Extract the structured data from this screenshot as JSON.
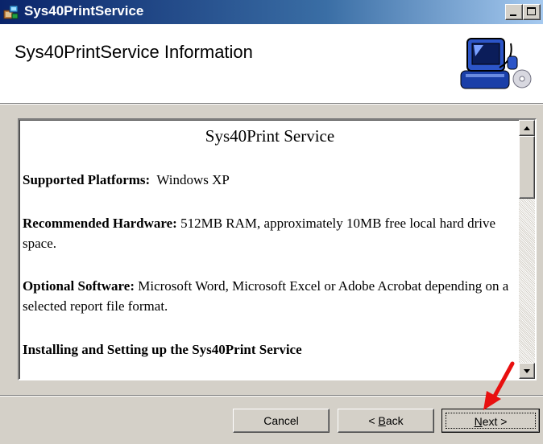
{
  "window": {
    "title": "Sys40PrintService",
    "icon": "installer-icon"
  },
  "header": {
    "heading": "Sys40PrintService Information",
    "logo": "computer-cd-logo-icon"
  },
  "document": {
    "title": "Sys40Print Service",
    "platforms_label": "Supported Platforms:",
    "platforms_value": "Windows XP",
    "hardware_label": "Recommended Hardware:",
    "hardware_value": "512MB RAM, approximately 10MB free local hard drive space.",
    "software_label": "Optional Software:",
    "software_value": "Microsoft Word, Microsoft Excel or Adobe Acrobat depending on a selected report file format.",
    "installing_heading": "Installing and Setting up the Sys40Print Service"
  },
  "buttons": {
    "cancel": "Cancel",
    "back_prefix": "< ",
    "back_mnemonic": "B",
    "back_rest": "ack",
    "next_mnemonic": "N",
    "next_rest": "ext >"
  },
  "annotation": {
    "arrow_color": "#e81010"
  },
  "colors": {
    "titlebar_start": "#0a246a",
    "titlebar_end": "#a6caf0",
    "dialog_face": "#d4d0c8"
  }
}
